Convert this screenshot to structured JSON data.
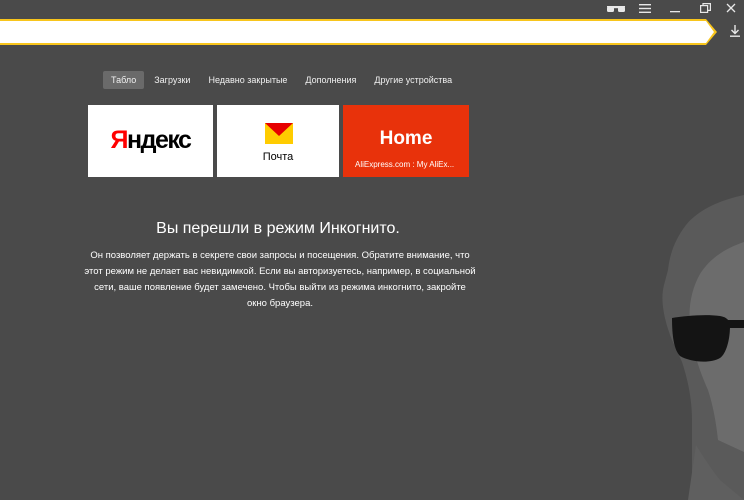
{
  "window": {
    "incognito_icon": "glasses-icon",
    "menu_icon": "hamburger-menu-icon",
    "minimize_icon": "minimize-icon",
    "restore_icon": "restore-icon",
    "close_icon": "close-icon"
  },
  "addressbar": {
    "value": "",
    "accent_color": "#f8c51c"
  },
  "tabs": [
    {
      "label": "Табло",
      "active": true
    },
    {
      "label": "Загрузки"
    },
    {
      "label": "Недавно закрытые"
    },
    {
      "label": "Дополнения"
    },
    {
      "label": "Другие устройства"
    }
  ],
  "tiles": {
    "yandex": {
      "logo_first": "Я",
      "logo_rest": "ндекс"
    },
    "mail": {
      "label": "Почта",
      "icon": "mail-envelope-icon"
    },
    "aliexpress": {
      "title": "Home",
      "subtitle": "AliExpress.com : My AliEx..."
    }
  },
  "incognito": {
    "title": "Вы перешли в режим Инкогнито.",
    "lines": [
      "Он позволяет держать в секрете свои запросы и посещения. Обратите внимание, что",
      "этот режим не делает вас невидимкой. Если вы авторизуетесь, например, в социальной",
      "сети, ваше появление будет замечено. Чтобы выйти из режима инкогнито, закройте",
      "окно браузера."
    ]
  }
}
